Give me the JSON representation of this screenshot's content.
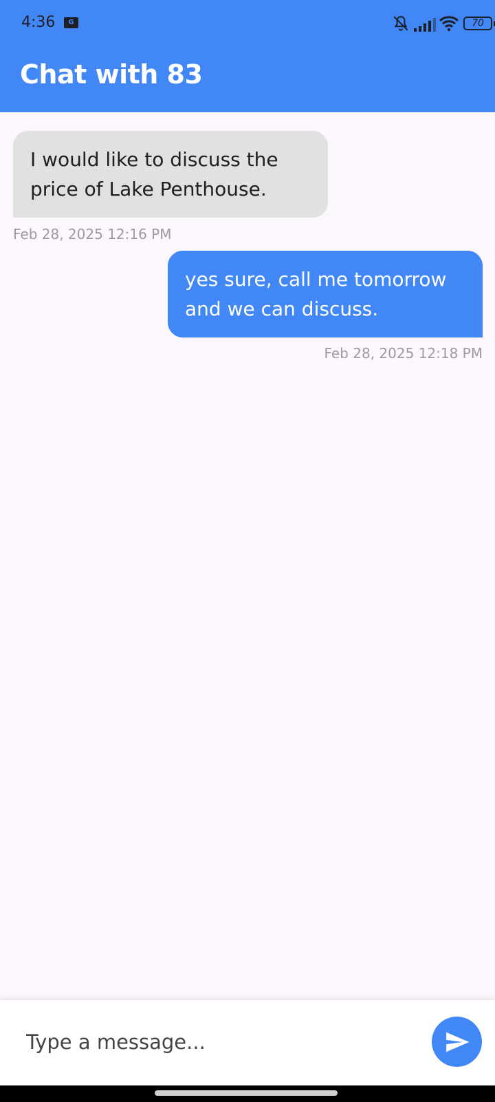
{
  "status_bar": {
    "time": "4:36",
    "notification_icon": "gmail-icon",
    "icons": [
      "bell-off-icon",
      "signal-icon",
      "wifi-icon",
      "battery-icon"
    ],
    "battery_level": "70"
  },
  "header": {
    "title": "Chat with 83",
    "background_color": "#4187f6"
  },
  "messages": [
    {
      "direction": "incoming",
      "text": "I would like to discuss the price of Lake Penthouse.",
      "timestamp": "Feb 28, 2025 12:16 PM",
      "bubble_color": "#e1e1e1"
    },
    {
      "direction": "outgoing",
      "text": "yes sure, call me tomorrow and we can discuss.",
      "timestamp": "Feb 28, 2025 12:18 PM",
      "bubble_color": "#4187f6"
    }
  ],
  "composer": {
    "placeholder": "Type a message...",
    "value": "",
    "send_icon": "send-icon"
  },
  "colors": {
    "accent": "#4187f6",
    "background": "#fcf6fd",
    "timestamp": "#9b9b9b"
  }
}
